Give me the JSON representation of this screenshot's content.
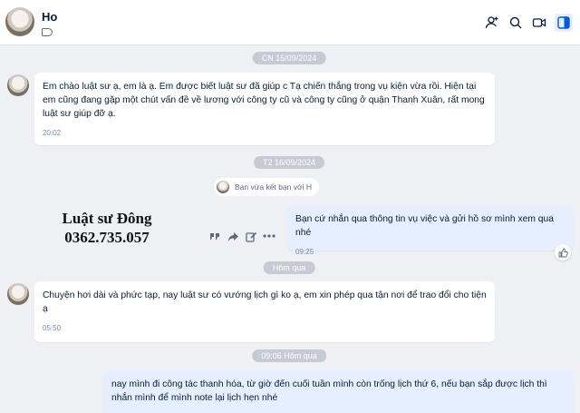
{
  "header": {
    "contact_name": "Ho",
    "icons": [
      "add-member-icon",
      "search-icon",
      "video-call-icon",
      "sidebar-toggle-icon"
    ]
  },
  "dates": {
    "d1": "CN 15/09/2024",
    "d2": "T2 16/09/2024",
    "d3": "Hôm qua",
    "d4": "09:06 Hôm qua"
  },
  "messages": {
    "m1": {
      "text": "Em chào luật sư ạ, em là          ạ. Em được biết luật sư đã giúp c Tạ        chiến thắng trong vụ kiện vừa rồi. Hiện tại em cũng đang gặp một chút vấn đề về lương với công ty cũ và công ty cũng ở quận Thanh Xuân, rất mong luật sư giúp đỡ ạ.",
      "time": "20:02"
    },
    "system": "Bạn vừa kết bạn với H",
    "m2": {
      "text": "Bạn cứ nhắn qua thông tin vụ việc và gửi hồ sơ mình xem qua nhé",
      "time": "09:25"
    },
    "m3": {
      "text": "Chuyện hơi dài và phức tạp, nay luật sư có vướng lịch gì ko ạ, em xin phép qua tận nơi để trao đổi cho tiện ạ",
      "time": "05:50"
    },
    "m4": {
      "text": "nay mình đi công tác thanh hóa, từ giờ đến cuối tuần mình còn trống lịch thứ 6, nếu bạn sắp được lịch thì nhắn mình để mình note lại lịch hẹn nhé"
    }
  },
  "watermark": {
    "line1": "Luật sư Đông",
    "line2": "0362.735.057"
  }
}
